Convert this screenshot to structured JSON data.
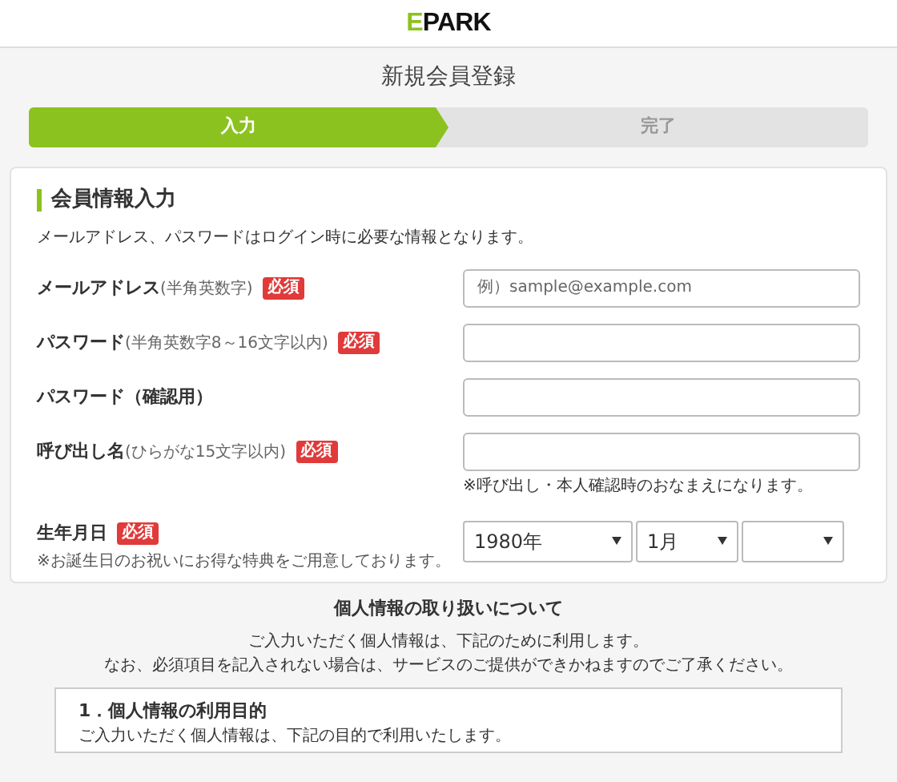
{
  "logo": {
    "accent": "E",
    "rest": "PARK"
  },
  "title": "新規会員登録",
  "steps": [
    {
      "label": "入力",
      "selected": true
    },
    {
      "label": "完了",
      "selected": false
    }
  ],
  "form": {
    "heading": "会員情報入力",
    "description": "メールアドレス、パスワードはログイン時に必要な情報となります。",
    "fields": [
      {
        "kind": "text",
        "label": "メールアドレス",
        "hint": "(半角英数字)",
        "badge": "必須",
        "placeholder": "例）sample@example.com"
      },
      {
        "kind": "text",
        "label": "パスワード",
        "hint": "(半角英数字8～16文字以内)",
        "badge": "必須"
      },
      {
        "kind": "text",
        "label": "パスワード（確認用）"
      },
      {
        "kind": "text",
        "label": "呼び出し名",
        "hint": "(ひらがな15文字以内)",
        "badge": "必須",
        "note": "※呼び出し・本人確認時のおなまえになります。"
      },
      {
        "kind": "date",
        "label": "生年月日",
        "badge": "必須",
        "subnote": "※お誕生日のお祝いにお得な特典をご用意しております。",
        "selects": [
          {
            "kind": "value",
            "value": "1980年"
          },
          {
            "kind": "value",
            "value": "1月"
          },
          {
            "kind": "blank"
          }
        ]
      }
    ]
  },
  "privacy": {
    "heading": "個人情報の取り扱いについて",
    "lines": [
      "ご入力いただく個人情報は、下記のために利用します。",
      "なお、必須項目を記入されない場合は、サービスのご提供ができかねますのでご了承ください。"
    ],
    "box_heading": "1．個人情報の利用目的",
    "box_text": "ご入力いただく個人情報は、下記の目的で利用いたします。"
  }
}
